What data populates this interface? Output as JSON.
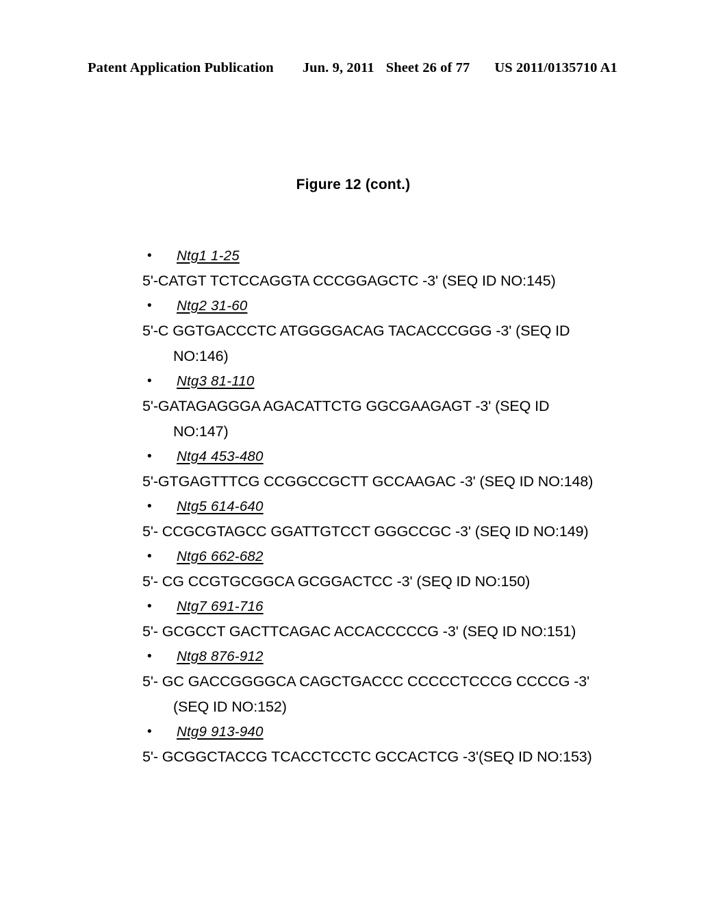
{
  "header": {
    "publication": "Patent Application Publication",
    "date": "Jun. 9, 2011",
    "sheet": "Sheet 26 of 77",
    "doc_number": "US 2011/0135710 A1"
  },
  "figure": {
    "title": "Figure 12 (cont.)"
  },
  "sequences": [
    {
      "bullet": "•",
      "name": "Ntg1 1-25",
      "text": "5'-CATGT TCTCCAGGTA CCCGGAGCTC  -3' (SEQ ID NO:145)"
    },
    {
      "bullet": "•",
      "name": "Ntg2 31-60",
      "text": "5'-C GGTGACCCTC ATGGGGACAG TACACCCGGG  -3' (SEQ ID NO:146)"
    },
    {
      "bullet": "•",
      "name": "Ntg3 81-110",
      "text": "5'-GATAGAGGGA AGACATTCTG GGCGAAGAGT  -3' (SEQ ID NO:147)"
    },
    {
      "bullet": "•",
      "name": "Ntg4 453-480",
      "text": "5'-GTGAGTTTCG CCGGCCGCTT GCCAAGAC  -3' (SEQ ID NO:148)"
    },
    {
      "bullet": "•",
      "name": "Ntg5 614-640",
      "text": "5'- CCGCGTAGCC GGATTGTCCT GGGCCGC -3' (SEQ ID NO:149)"
    },
    {
      "bullet": "•",
      "name": "Ntg6 662-682",
      "text": "5'- CG CCGTGCGGCA GCGGACTCC -3' (SEQ ID NO:150)"
    },
    {
      "bullet": "•",
      "name": "Ntg7 691-716",
      "text": "5'- GCGCCT GACTTCAGAC ACCACCCCCG -3' (SEQ ID NO:151)"
    },
    {
      "bullet": "•",
      "name": "Ntg8 876-912",
      "text": "5'- GC GACCGGGGCA CAGCTGACCC CCCCCTCCCG CCCCG -3' (SEQ ID NO:152)"
    },
    {
      "bullet": "•",
      "name": "Ntg9 913-940",
      "text": "5'- GCGGCTACCG TCACCTCCTC GCCACTCG -3'(SEQ ID NO:153)"
    }
  ]
}
